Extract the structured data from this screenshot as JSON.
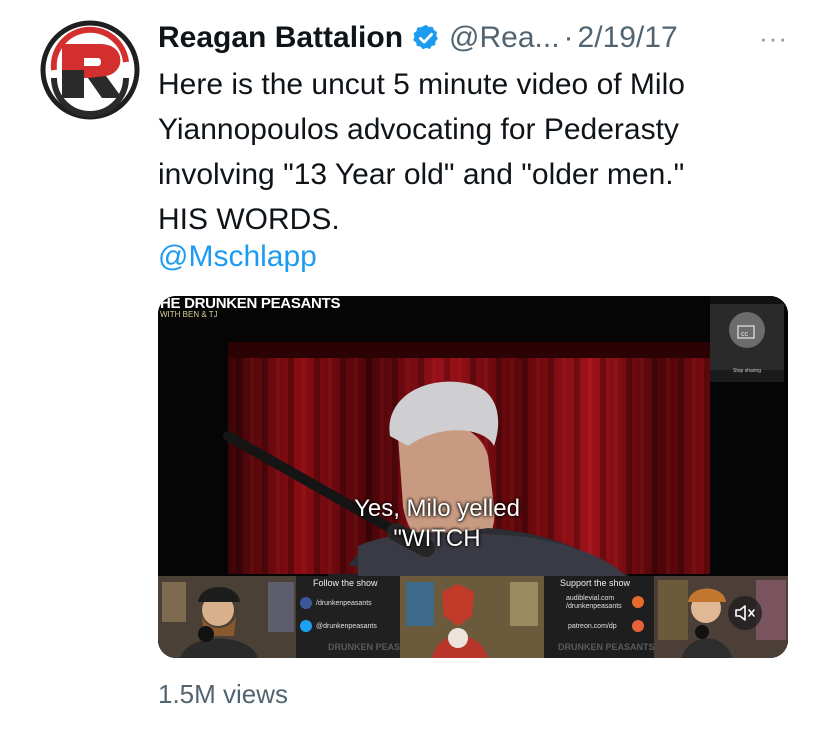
{
  "tweet": {
    "author": {
      "display_name": "Reagan Battalion",
      "handle": "@Rea...",
      "avatar_icon": "reagan-battalion-r-logo"
    },
    "date": "2/19/17",
    "separator": "·",
    "more_label": "···",
    "text_lines": [
      "Here is the uncut 5 minute video of Milo",
      "Yiannopoulos advocating for Pederasty",
      "involving \"13 Year old\" and \"older men.\"",
      "HIS WORDS."
    ],
    "mention": "@Mschlapp",
    "views": "1.5M views"
  },
  "video": {
    "caption_line1": "Yes, Milo yelled",
    "caption_line2": "\"WITCH",
    "show_title": "HE DRUNKEN PEASANTS",
    "show_subtitle": "WITH BEN & TJ",
    "follow_label": "Follow the show",
    "facebook_handle": "/drunkenpeasants",
    "twitter_handle": "@drunkenpeasants",
    "support_label": "Support the show",
    "support_line1": "audiblevial.com",
    "support_line2": "/drunkenpeasants",
    "support_line3": "patreon.com/dp",
    "pip_label": "Stop sharing",
    "muted": true
  },
  "colors": {
    "text_primary": "#0f1419",
    "text_secondary": "#536471",
    "link": "#1d9bf0",
    "verified_badge": "#1d9bf0",
    "logo_red": "#d32f2f"
  }
}
